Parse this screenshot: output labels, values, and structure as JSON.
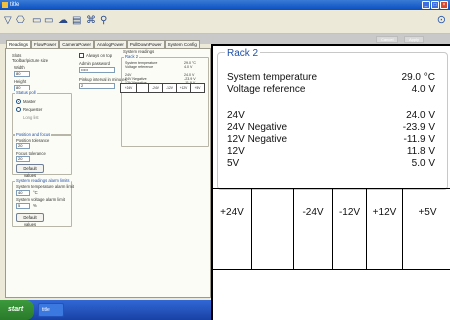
{
  "window": {
    "title": "title"
  },
  "toolbar": {
    "items": [
      "▽",
      "⎔",
      "▭",
      "▭",
      "☁",
      "▤",
      "⌘",
      "⚲"
    ],
    "right_icon": "⊙"
  },
  "graybar": {
    "button_a": "Cancel",
    "button_b": "Apply"
  },
  "tabs": [
    "Readings",
    "FlowPower",
    "CameraPower",
    "AnalogPower",
    "PullDownPower",
    "System Config"
  ],
  "left": {
    "slots_label": "Slots",
    "slots_sublabel": "Toolbar/picture size",
    "width_label": "Width",
    "width_value": "80",
    "height_label": "Height",
    "height_value": "80",
    "status_group": "Status poll",
    "radio_a": "Master",
    "radio_b": "Requester",
    "radio_b_sub": "Long list",
    "position_group": "Position and focus",
    "position_label": "Position tolerance",
    "position_value": "20",
    "focus_label": "Focus tolerance",
    "focus_value": "20",
    "default_button": "Default values",
    "alarm_group": "System readings alarm limits",
    "temp_limit_label": "System temperature alarm limit",
    "temp_limit_value": "40",
    "temp_limit_unit": "°C",
    "volt_limit_label": "System voltage alarm limit",
    "volt_limit_value": "5",
    "volt_limit_unit": "%",
    "default_button2": "Default values"
  },
  "middle": {
    "always_on_top": "Always on top",
    "admin_password_label": "Admin password",
    "admin_password_value": "•••••",
    "interval_label": "Pinkup interval in minutes",
    "interval_value": "2"
  },
  "rack_small": {
    "group_title": "System readings",
    "legend": "Rack 2",
    "rows": [
      {
        "label": "System temperature",
        "value": "29.0 °C"
      },
      {
        "label": "Voltage reference",
        "value": "4.0 V"
      },
      {
        "label": "24V",
        "value": "24.0 V"
      },
      {
        "label": "24V Negative",
        "value": "-23.9 V"
      },
      {
        "label": "12V Negative",
        "value": "-11.9 V"
      },
      {
        "label": "12V",
        "value": "11.8 V"
      },
      {
        "label": "5V",
        "value": "5.0 V"
      }
    ],
    "table": [
      "+24V",
      "",
      "-24V",
      "-12V",
      "+12V",
      "+5V"
    ]
  },
  "taskbar": {
    "start": "start",
    "task": "title"
  },
  "rack": {
    "legend": "Rack 2",
    "rows": [
      {
        "label": "System temperature",
        "value": "29.0 °C"
      },
      {
        "label": "Voltage reference",
        "value": "4.0 V"
      },
      {
        "label": "24V",
        "value": "24.0 V"
      },
      {
        "label": "24V Negative",
        "value": "-23.9 V"
      },
      {
        "label": "12V Negative",
        "value": "-11.9 V"
      },
      {
        "label": "12V",
        "value": "11.8 V"
      },
      {
        "label": "5V",
        "value": "5.0 V"
      }
    ],
    "table": [
      "+24V",
      "",
      "-24V",
      "-12V",
      "+12V",
      "+5V"
    ]
  }
}
